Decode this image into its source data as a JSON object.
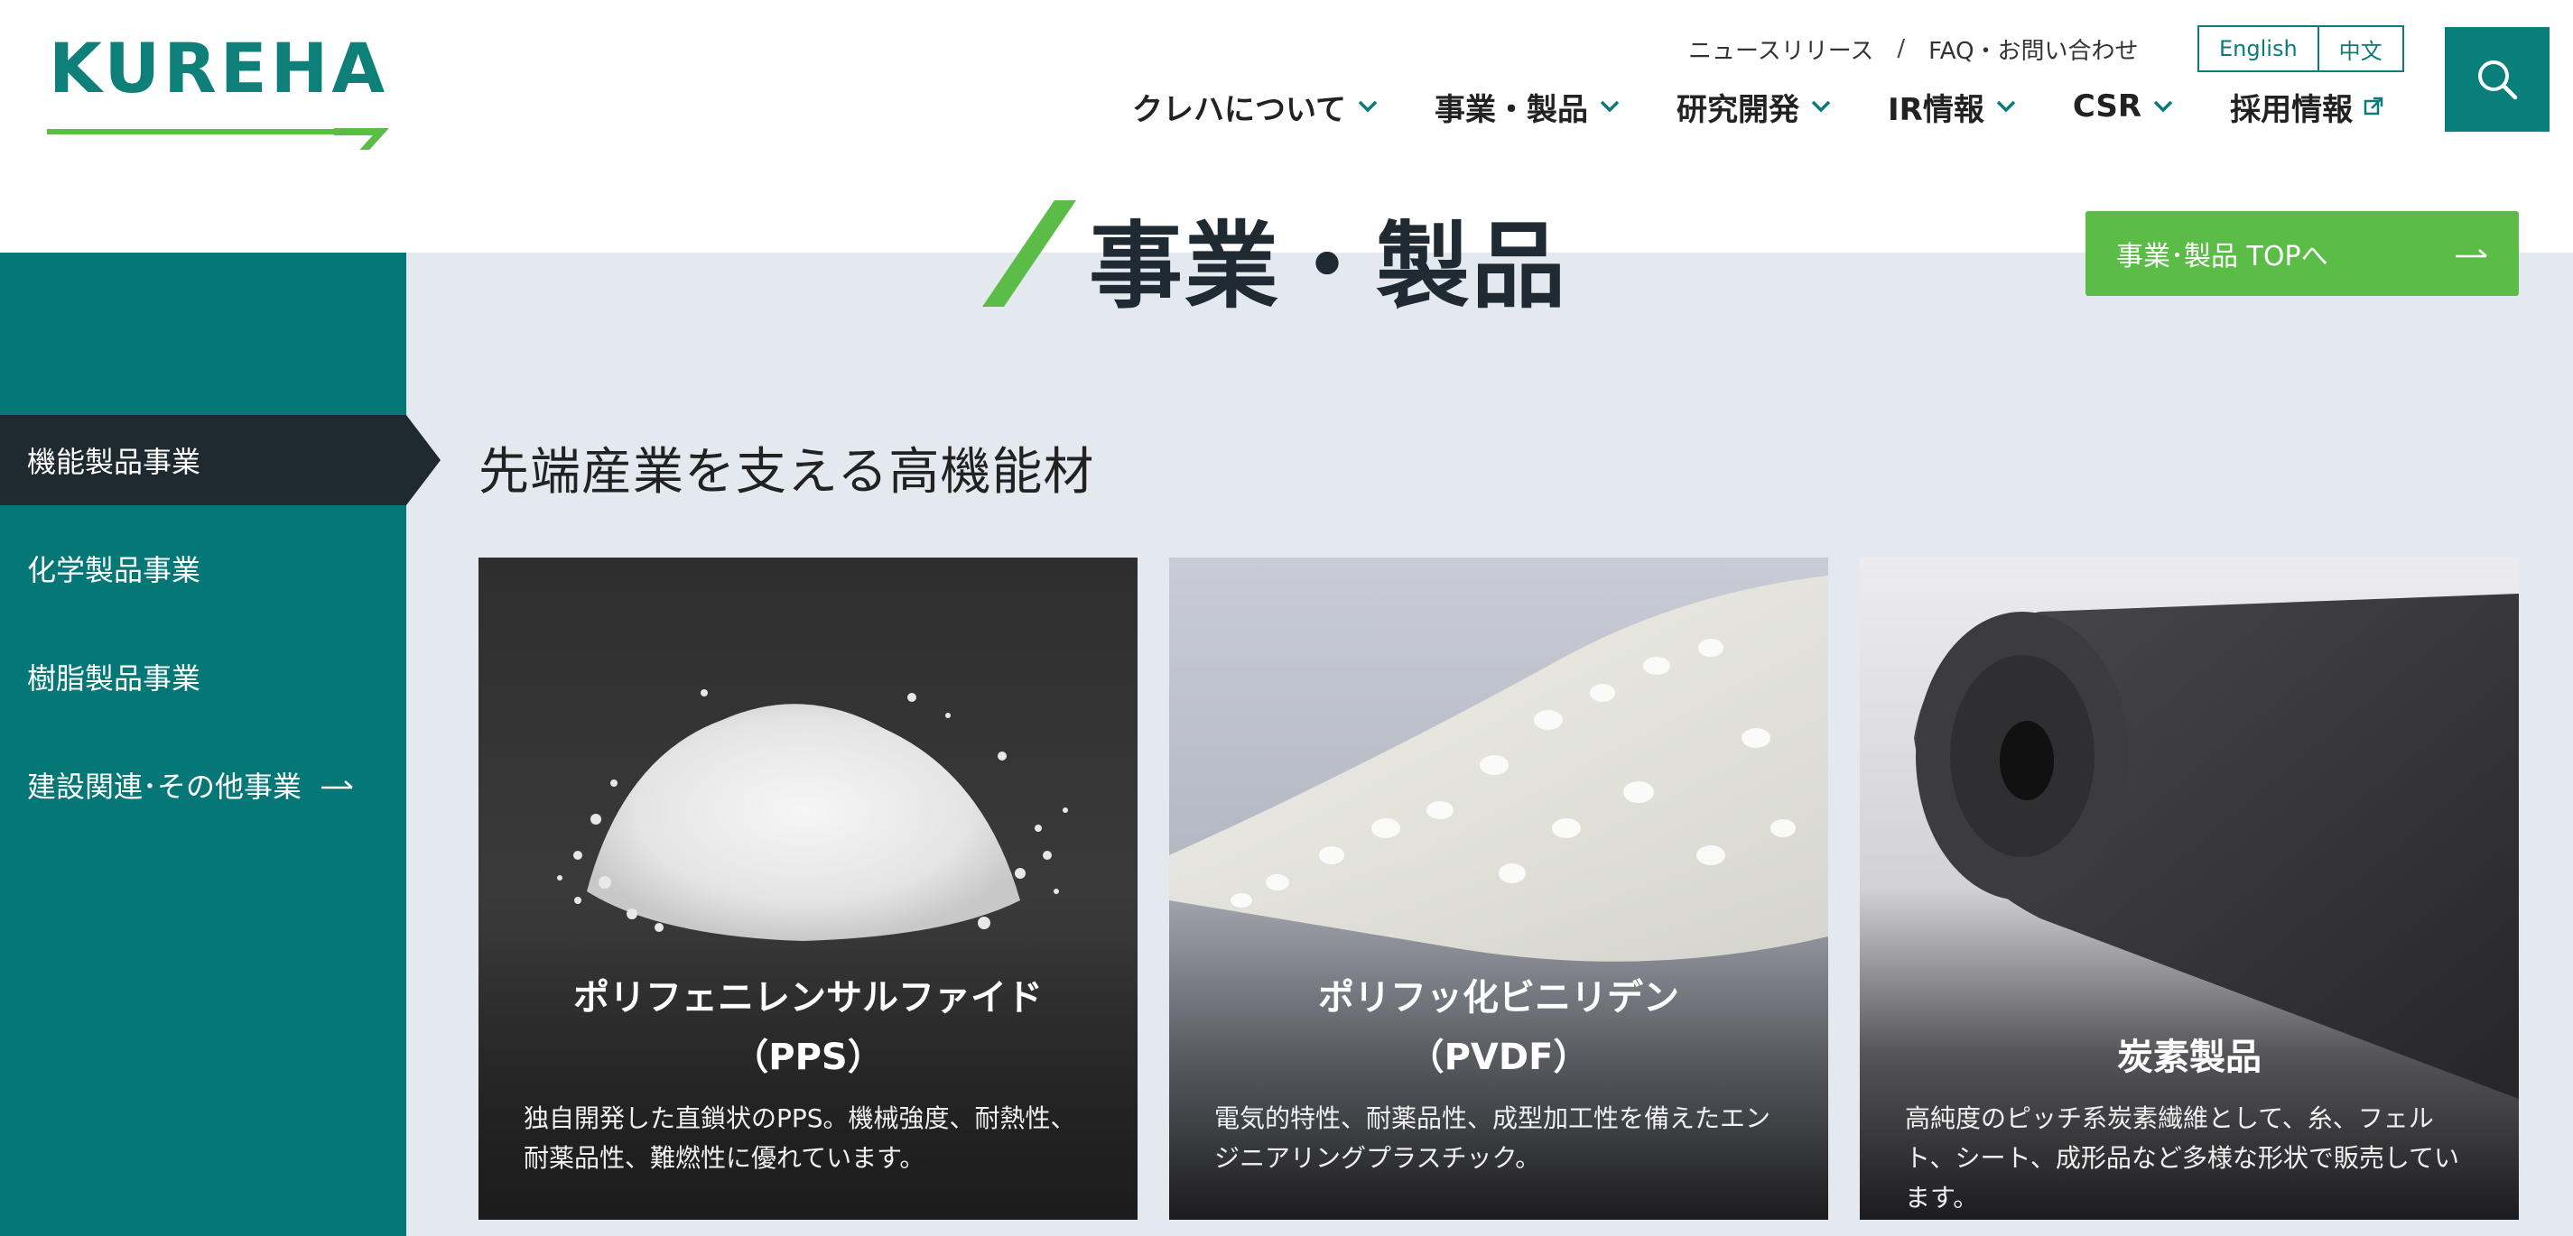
{
  "header": {
    "logo_text": "KUREHA",
    "utility_links": [
      "ニュースリリース",
      "FAQ・お問い合わせ"
    ],
    "utility_separator": "/",
    "languages": [
      "English",
      "中文"
    ],
    "search_icon": "search-icon",
    "nav": [
      {
        "label": "クレハについて",
        "icon": "chevron-down-icon"
      },
      {
        "label": "事業・製品",
        "icon": "chevron-down-icon"
      },
      {
        "label": "研究開発",
        "icon": "chevron-down-icon"
      },
      {
        "label": "IR情報",
        "icon": "chevron-down-icon"
      },
      {
        "label": "CSR",
        "icon": "chevron-down-icon"
      },
      {
        "label": "採用情報",
        "icon": "external-link-icon"
      }
    ]
  },
  "page": {
    "title": "事業・製品",
    "top_button_label": "事業･製品 TOPへ"
  },
  "sidebar": {
    "items": [
      {
        "label": "機能製品事業",
        "active": true
      },
      {
        "label": "化学製品事業",
        "active": false
      },
      {
        "label": "樹脂製品事業",
        "active": false
      },
      {
        "label": "建設関連･その他事業",
        "active": false,
        "icon": "arrow-right-icon"
      }
    ]
  },
  "section": {
    "title": "先端産業を支える高機能材",
    "cards": [
      {
        "name_line1": "ポリフェニレンサルファイド",
        "name_line2": "（PPS）",
        "desc_line1": "独自開発した直鎖状のPPS。機械強度、耐熱性、",
        "desc_line2": "耐薬品性、難燃性に優れています。",
        "desc_line3": ""
      },
      {
        "name_line1": "ポリフッ化ビニリデン",
        "name_line2": "（PVDF）",
        "desc_line1": "電気的特性、耐薬品性、成型加工性を備えたエン",
        "desc_line2": "ジニアリングプラスチック。",
        "desc_line3": ""
      },
      {
        "name_line1": "",
        "name_line2": "炭素製品",
        "desc_line1": "高純度のピッチ系炭素繊維として、糸、フェル",
        "desc_line2": "ト、シート、成形品など多様な形状で販売してい",
        "desc_line3": "ます。"
      }
    ]
  },
  "colors": {
    "teal": "#057776",
    "green": "#5bbd48",
    "dark": "#1e2a30",
    "page_bg": "#e4e9f0"
  }
}
